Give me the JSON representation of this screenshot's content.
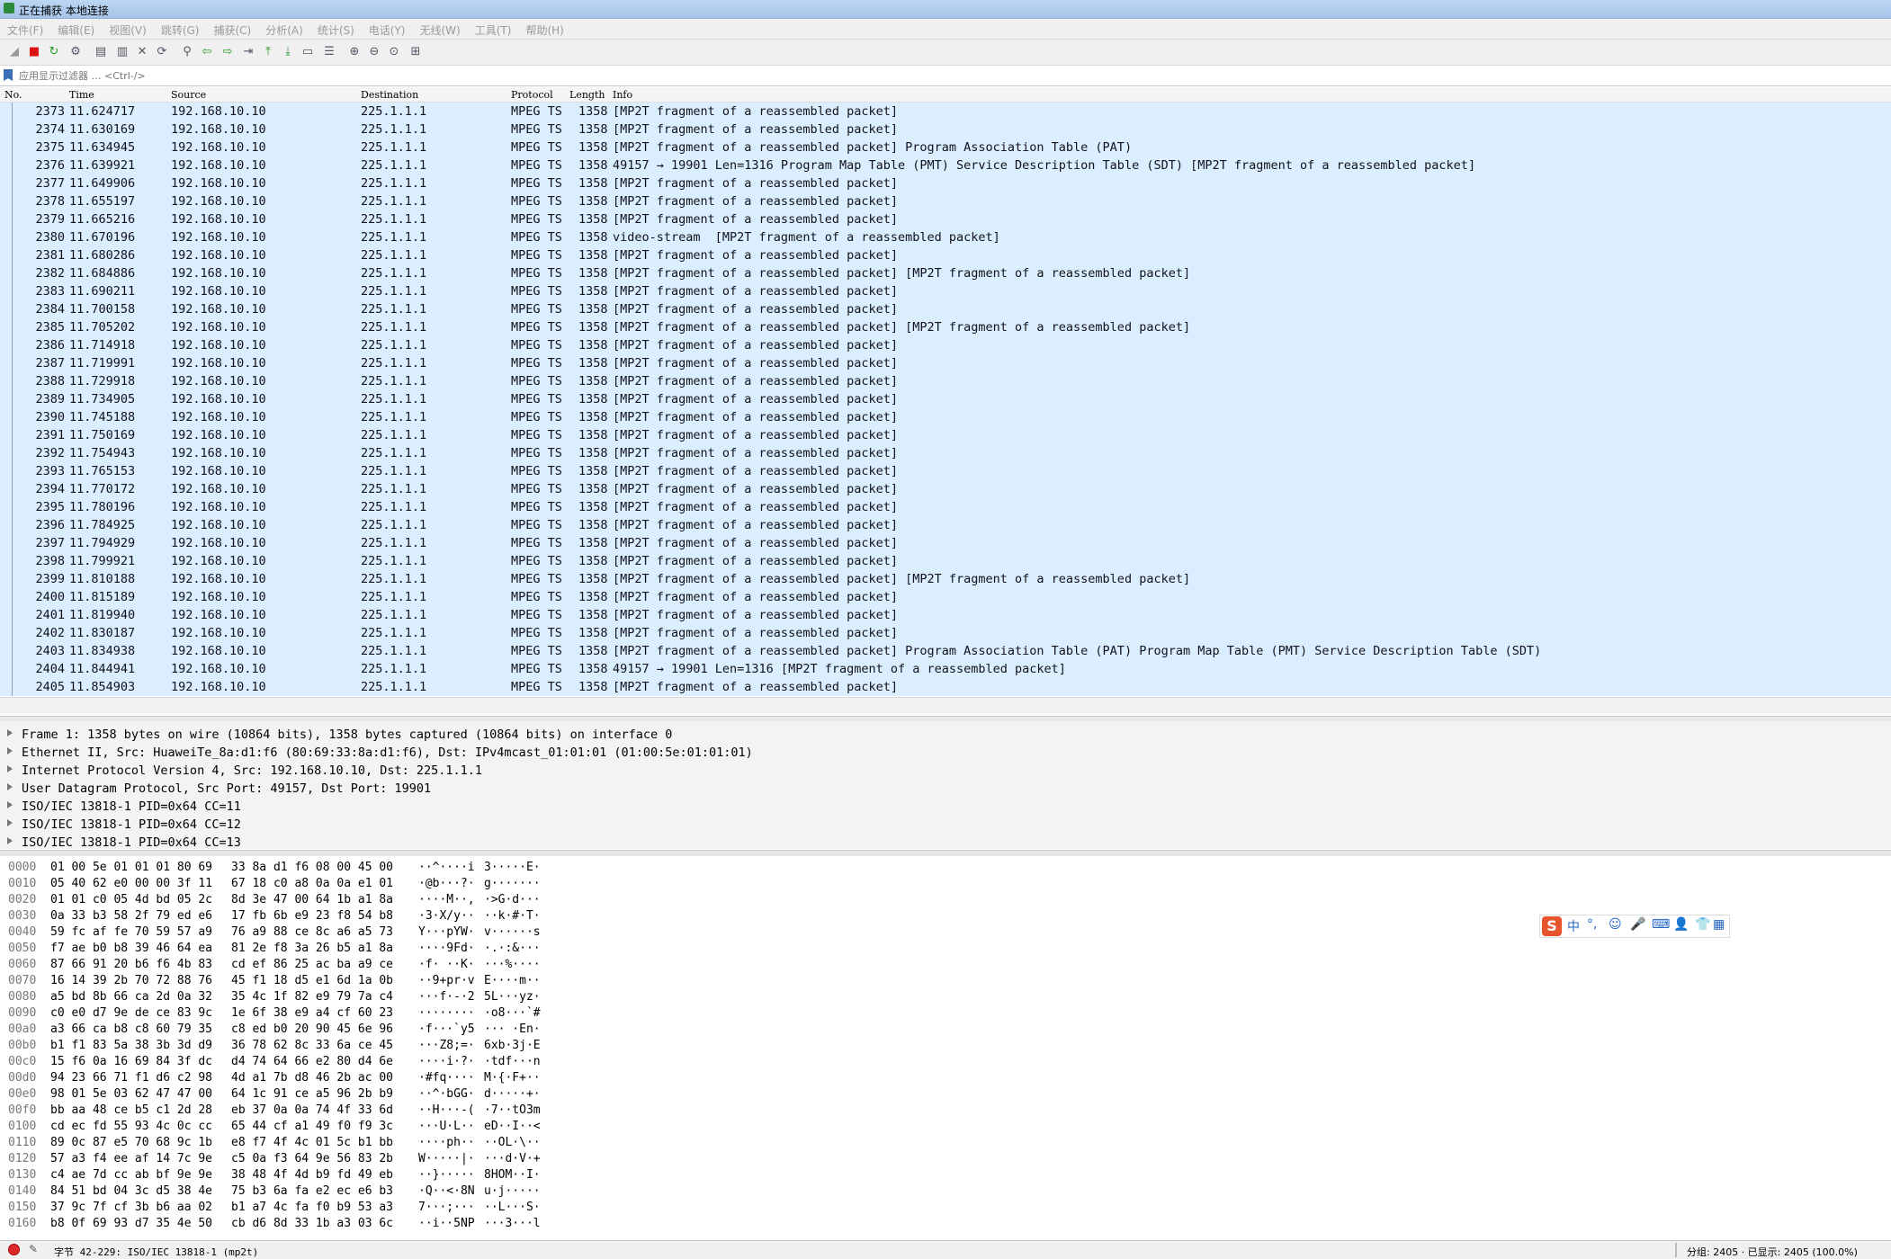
{
  "window": {
    "title": "正在捕获 本地连接"
  },
  "menu": [
    "文件(F)",
    "编辑(E)",
    "视图(V)",
    "跳转(G)",
    "捕获(C)",
    "分析(A)",
    "统计(S)",
    "电话(Y)",
    "无线(W)",
    "工具(T)",
    "帮助(H)"
  ],
  "toolbar": {
    "icons": [
      "shark-fin-icon",
      "stop-icon",
      "restart-icon",
      "options-gear-icon",
      "open-file-icon",
      "save-file-icon",
      "close-file-icon",
      "reload-icon",
      "find-icon",
      "go-back-icon",
      "go-forward-icon",
      "go-to-packet-icon",
      "go-first-icon",
      "go-last-icon",
      "autoscroll-icon",
      "colorize-icon",
      "zoom-in-icon",
      "zoom-out-icon",
      "zoom-normal-icon",
      "resize-columns-icon"
    ]
  },
  "filter": {
    "placeholder": "应用显示过滤器 … <Ctrl-/>"
  },
  "packet_list": {
    "columns": [
      "No.",
      "Time",
      "Source",
      "Destination",
      "Protocol",
      "Length",
      "Info"
    ],
    "rows": [
      [
        "2373",
        "11.624717",
        "192.168.10.10",
        "225.1.1.1",
        "MPEG TS",
        "1358",
        "[MP2T fragment of a reassembled packet]"
      ],
      [
        "2374",
        "11.630169",
        "192.168.10.10",
        "225.1.1.1",
        "MPEG TS",
        "1358",
        "[MP2T fragment of a reassembled packet]"
      ],
      [
        "2375",
        "11.634945",
        "192.168.10.10",
        "225.1.1.1",
        "MPEG TS",
        "1358",
        "[MP2T fragment of a reassembled packet] Program Association Table (PAT)"
      ],
      [
        "2376",
        "11.639921",
        "192.168.10.10",
        "225.1.1.1",
        "MPEG TS",
        "1358",
        "49157 → 19901 Len=1316 Program Map Table (PMT) Service Description Table (SDT) [MP2T fragment of a reassembled packet]"
      ],
      [
        "2377",
        "11.649906",
        "192.168.10.10",
        "225.1.1.1",
        "MPEG TS",
        "1358",
        "[MP2T fragment of a reassembled packet]"
      ],
      [
        "2378",
        "11.655197",
        "192.168.10.10",
        "225.1.1.1",
        "MPEG TS",
        "1358",
        "[MP2T fragment of a reassembled packet]"
      ],
      [
        "2379",
        "11.665216",
        "192.168.10.10",
        "225.1.1.1",
        "MPEG TS",
        "1358",
        "[MP2T fragment of a reassembled packet]"
      ],
      [
        "2380",
        "11.670196",
        "192.168.10.10",
        "225.1.1.1",
        "MPEG TS",
        "1358",
        "video-stream  [MP2T fragment of a reassembled packet]"
      ],
      [
        "2381",
        "11.680286",
        "192.168.10.10",
        "225.1.1.1",
        "MPEG TS",
        "1358",
        "[MP2T fragment of a reassembled packet]"
      ],
      [
        "2382",
        "11.684886",
        "192.168.10.10",
        "225.1.1.1",
        "MPEG TS",
        "1358",
        "[MP2T fragment of a reassembled packet] [MP2T fragment of a reassembled packet]"
      ],
      [
        "2383",
        "11.690211",
        "192.168.10.10",
        "225.1.1.1",
        "MPEG TS",
        "1358",
        "[MP2T fragment of a reassembled packet]"
      ],
      [
        "2384",
        "11.700158",
        "192.168.10.10",
        "225.1.1.1",
        "MPEG TS",
        "1358",
        "[MP2T fragment of a reassembled packet]"
      ],
      [
        "2385",
        "11.705202",
        "192.168.10.10",
        "225.1.1.1",
        "MPEG TS",
        "1358",
        "[MP2T fragment of a reassembled packet] [MP2T fragment of a reassembled packet]"
      ],
      [
        "2386",
        "11.714918",
        "192.168.10.10",
        "225.1.1.1",
        "MPEG TS",
        "1358",
        "[MP2T fragment of a reassembled packet]"
      ],
      [
        "2387",
        "11.719991",
        "192.168.10.10",
        "225.1.1.1",
        "MPEG TS",
        "1358",
        "[MP2T fragment of a reassembled packet]"
      ],
      [
        "2388",
        "11.729918",
        "192.168.10.10",
        "225.1.1.1",
        "MPEG TS",
        "1358",
        "[MP2T fragment of a reassembled packet]"
      ],
      [
        "2389",
        "11.734905",
        "192.168.10.10",
        "225.1.1.1",
        "MPEG TS",
        "1358",
        "[MP2T fragment of a reassembled packet]"
      ],
      [
        "2390",
        "11.745188",
        "192.168.10.10",
        "225.1.1.1",
        "MPEG TS",
        "1358",
        "[MP2T fragment of a reassembled packet]"
      ],
      [
        "2391",
        "11.750169",
        "192.168.10.10",
        "225.1.1.1",
        "MPEG TS",
        "1358",
        "[MP2T fragment of a reassembled packet]"
      ],
      [
        "2392",
        "11.754943",
        "192.168.10.10",
        "225.1.1.1",
        "MPEG TS",
        "1358",
        "[MP2T fragment of a reassembled packet]"
      ],
      [
        "2393",
        "11.765153",
        "192.168.10.10",
        "225.1.1.1",
        "MPEG TS",
        "1358",
        "[MP2T fragment of a reassembled packet]"
      ],
      [
        "2394",
        "11.770172",
        "192.168.10.10",
        "225.1.1.1",
        "MPEG TS",
        "1358",
        "[MP2T fragment of a reassembled packet]"
      ],
      [
        "2395",
        "11.780196",
        "192.168.10.10",
        "225.1.1.1",
        "MPEG TS",
        "1358",
        "[MP2T fragment of a reassembled packet]"
      ],
      [
        "2396",
        "11.784925",
        "192.168.10.10",
        "225.1.1.1",
        "MPEG TS",
        "1358",
        "[MP2T fragment of a reassembled packet]"
      ],
      [
        "2397",
        "11.794929",
        "192.168.10.10",
        "225.1.1.1",
        "MPEG TS",
        "1358",
        "[MP2T fragment of a reassembled packet]"
      ],
      [
        "2398",
        "11.799921",
        "192.168.10.10",
        "225.1.1.1",
        "MPEG TS",
        "1358",
        "[MP2T fragment of a reassembled packet]"
      ],
      [
        "2399",
        "11.810188",
        "192.168.10.10",
        "225.1.1.1",
        "MPEG TS",
        "1358",
        "[MP2T fragment of a reassembled packet] [MP2T fragment of a reassembled packet]"
      ],
      [
        "2400",
        "11.815189",
        "192.168.10.10",
        "225.1.1.1",
        "MPEG TS",
        "1358",
        "[MP2T fragment of a reassembled packet]"
      ],
      [
        "2401",
        "11.819940",
        "192.168.10.10",
        "225.1.1.1",
        "MPEG TS",
        "1358",
        "[MP2T fragment of a reassembled packet]"
      ],
      [
        "2402",
        "11.830187",
        "192.168.10.10",
        "225.1.1.1",
        "MPEG TS",
        "1358",
        "[MP2T fragment of a reassembled packet]"
      ],
      [
        "2403",
        "11.834938",
        "192.168.10.10",
        "225.1.1.1",
        "MPEG TS",
        "1358",
        "[MP2T fragment of a reassembled packet] Program Association Table (PAT) Program Map Table (PMT) Service Description Table (SDT)"
      ],
      [
        "2404",
        "11.844941",
        "192.168.10.10",
        "225.1.1.1",
        "MPEG TS",
        "1358",
        "49157 → 19901 Len=1316 [MP2T fragment of a reassembled packet]"
      ],
      [
        "2405",
        "11.854903",
        "192.168.10.10",
        "225.1.1.1",
        "MPEG TS",
        "1358",
        "[MP2T fragment of a reassembled packet]"
      ]
    ]
  },
  "details": [
    "Frame 1: 1358 bytes on wire (10864 bits), 1358 bytes captured (10864 bits) on interface 0",
    "Ethernet II, Src: HuaweiTe_8a:d1:f6 (80:69:33:8a:d1:f6), Dst: IPv4mcast_01:01:01 (01:00:5e:01:01:01)",
    "Internet Protocol Version 4, Src: 192.168.10.10, Dst: 225.1.1.1",
    "User Datagram Protocol, Src Port: 49157, Dst Port: 19901",
    "ISO/IEC 13818-1 PID=0x64 CC=11",
    "ISO/IEC 13818-1 PID=0x64 CC=12",
    "ISO/IEC 13818-1 PID=0x64 CC=13"
  ],
  "bytes": [
    [
      "0000",
      "01 00 5e 01 01 01 80 69",
      "33 8a d1 f6 08 00 45 00",
      "··^····i",
      "3·····E·"
    ],
    [
      "0010",
      "05 40 62 e0 00 00 3f 11",
      "67 18 c0 a8 0a 0a e1 01",
      "·@b···?·",
      "g·······"
    ],
    [
      "0020",
      "01 01 c0 05 4d bd 05 2c",
      "8d 3e 47 00 64 1b a1 8a",
      "····M··,",
      "·>G·d···"
    ],
    [
      "0030",
      "0a 33 b3 58 2f 79 ed e6",
      "17 fb 6b e9 23 f8 54 b8",
      "·3·X/y··",
      "··k·#·T·"
    ],
    [
      "0040",
      "59 fc af fe 70 59 57 a9",
      "76 a9 88 ce 8c a6 a5 73",
      "Y···pYW·",
      "v······s"
    ],
    [
      "0050",
      "f7 ae b0 b8 39 46 64 ea",
      "81 2e f8 3a 26 b5 a1 8a",
      "····9Fd·",
      "·.·:&···"
    ],
    [
      "0060",
      "87 66 91 20 b6 f6 4b 83",
      "cd ef 86 25 ac ba a9 ce",
      "·f· ··K·",
      "···%····"
    ],
    [
      "0070",
      "16 14 39 2b 70 72 88 76",
      "45 f1 18 d5 e1 6d 1a 0b",
      "··9+pr·v",
      "E····m··"
    ],
    [
      "0080",
      "a5 bd 8b 66 ca 2d 0a 32",
      "35 4c 1f 82 e9 79 7a c4",
      "···f·-·2",
      "5L···yz·"
    ],
    [
      "0090",
      "c0 e0 d7 9e de ce 83 9c",
      "1e 6f 38 e9 a4 cf 60 23",
      "········",
      "·o8···`#"
    ],
    [
      "00a0",
      "a3 66 ca b8 c8 60 79 35",
      "c8 ed b0 20 90 45 6e 96",
      "·f···`y5",
      "··· ·En·"
    ],
    [
      "00b0",
      "b1 f1 83 5a 38 3b 3d d9",
      "36 78 62 8c 33 6a ce 45",
      "···Z8;=·",
      "6xb·3j·E"
    ],
    [
      "00c0",
      "15 f6 0a 16 69 84 3f dc",
      "d4 74 64 66 e2 80 d4 6e",
      "····i·?·",
      "·tdf···n"
    ],
    [
      "00d0",
      "94 23 66 71 f1 d6 c2 98",
      "4d a1 7b d8 46 2b ac 00",
      "·#fq····",
      "M·{·F+··"
    ],
    [
      "00e0",
      "98 01 5e 03 62 47 47 00",
      "64 1c 91 ce a5 96 2b b9",
      "··^·bGG·",
      "d·····+·"
    ],
    [
      "00f0",
      "bb aa 48 ce b5 c1 2d 28",
      "eb 37 0a 0a 74 4f 33 6d",
      "··H···-(",
      "·7··tO3m"
    ],
    [
      "0100",
      "cd ec fd 55 93 4c 0c cc",
      "65 44 cf a1 49 f0 f9 3c",
      "···U·L··",
      "eD··I··<"
    ],
    [
      "0110",
      "89 0c 87 e5 70 68 9c 1b",
      "e8 f7 4f 4c 01 5c b1 bb",
      "····ph··",
      "··OL·\\··"
    ],
    [
      "0120",
      "57 a3 f4 ee af 14 7c 9e",
      "c5 0a f3 64 9e 56 83 2b",
      "W·····|·",
      "···d·V·+"
    ],
    [
      "0130",
      "c4 ae 7d cc ab bf 9e 9e",
      "38 48 4f 4d b9 fd 49 eb",
      "··}·····",
      "8HOM··I·"
    ],
    [
      "0140",
      "84 51 bd 04 3c d5 38 4e",
      "75 b3 6a fa e2 ec e6 b3",
      "·Q··<·8N",
      "u·j·····"
    ],
    [
      "0150",
      "37 9c 7f cf 3b b6 aa 02",
      "b1 a7 4c fa f0 b9 53 a3",
      "7···;···",
      "··L···S·"
    ],
    [
      "0160",
      "b8 0f 69 93 d7 35 4e 50",
      "cb d6 8d 33 1b a3 03 6c",
      "··i··5NP",
      "···3···l"
    ]
  ],
  "ime": {
    "logo": "S",
    "items": [
      "中",
      "°,",
      "☺",
      "🎤",
      "⌨",
      "👤",
      "👕",
      "▦"
    ]
  },
  "status": {
    "left": "字节 42-229: ISO/IEC 13818-1 (mp2t)",
    "right": "分组: 2405 · 已显示: 2405 (100.0%)"
  },
  "colors": {
    "row_bg": "#daeeff",
    "titlebar": "#a6c4e8",
    "details_bg": "#f3f3f3"
  }
}
